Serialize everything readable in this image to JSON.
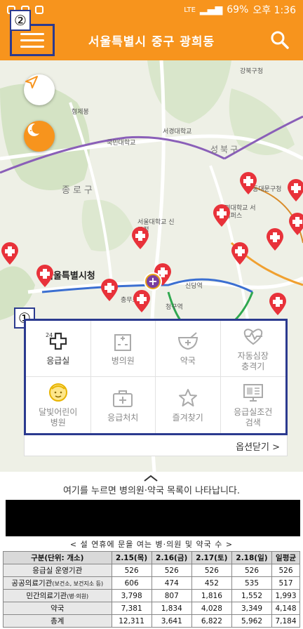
{
  "status_bar": {
    "battery": "69%",
    "time": "오후 1:36",
    "network": "LTE"
  },
  "header": {
    "title": "서울특별시 중구 광희동"
  },
  "callouts": {
    "menu": "②",
    "panel": "①"
  },
  "map": {
    "labels": {
      "city_hall": "서울특별시청",
      "jongno": "종로구",
      "seongbuk": "성북구",
      "gangbuk": "강북구청",
      "kookmin": "국민대학교",
      "seogyeong": "서경대학교",
      "korea_univ": "고려대학교 서울캠퍼스",
      "seoul_nat_ed": "서울대학교 신교정",
      "hyeonjebong": "형제봉",
      "dongdaemun": "동대문구청",
      "jongro_police": "종로",
      "chungmuro": "충무로역",
      "sindang": "신당역",
      "cheonggu": "청구역"
    },
    "colors": {
      "pin": "#e8323a",
      "route_purple": "#8a5fb8",
      "route_blue": "#3b6fd1"
    }
  },
  "menu_grid": {
    "items": [
      {
        "id": "emergency-room",
        "label": "응급실",
        "sup": "24",
        "icon": "cross-icon",
        "active": true
      },
      {
        "id": "hospital",
        "label": "병의원",
        "icon": "hospital-icon",
        "active": false
      },
      {
        "id": "pharmacy",
        "label": "약국",
        "icon": "mortar-icon",
        "active": false
      },
      {
        "id": "aed",
        "label": "자동심장\n충격기",
        "icon": "heartbeat-icon",
        "active": false
      },
      {
        "id": "moonlight",
        "label": "달빛어린이\n병원",
        "icon": "child-face-icon",
        "active": false
      },
      {
        "id": "first-aid",
        "label": "응급처치",
        "icon": "first-aid-kit-icon",
        "active": false
      },
      {
        "id": "favorites",
        "label": "즐겨찾기",
        "icon": "star-icon",
        "active": false
      },
      {
        "id": "er-status",
        "label": "응급실조건\n검색",
        "icon": "monitor-icon",
        "active": false
      }
    ],
    "options_close": "옵션닫기 >"
  },
  "hint": {
    "text": "여기를 누르면 병의원·약국 목록이 나타납니다."
  },
  "table": {
    "title": "< 설 연휴에 문을 여는 병·의원 및 약국 수 >",
    "headers": [
      "구분(단위: 개소)",
      "2.15(목)",
      "2.16(금)",
      "2.17(토)",
      "2.18(일)",
      "일평균"
    ],
    "rows": [
      {
        "label": "응급실 운영기관",
        "sub": "",
        "values": [
          "526",
          "526",
          "526",
          "526",
          "526"
        ]
      },
      {
        "label": "공공의료기관",
        "sub": "(보건소, 보건지소 등)",
        "values": [
          "606",
          "474",
          "452",
          "535",
          "517"
        ]
      },
      {
        "label": "민간의료기관",
        "sub": "(병·의원)",
        "values": [
          "3,798",
          "807",
          "1,816",
          "1,552",
          "1,993"
        ]
      },
      {
        "label": "약국",
        "sub": "",
        "values": [
          "7,381",
          "1,834",
          "4,028",
          "3,349",
          "4,148"
        ]
      },
      {
        "label": "총계",
        "sub": "",
        "values": [
          "12,311",
          "3,641",
          "6,822",
          "5,962",
          "7,184"
        ]
      }
    ]
  }
}
